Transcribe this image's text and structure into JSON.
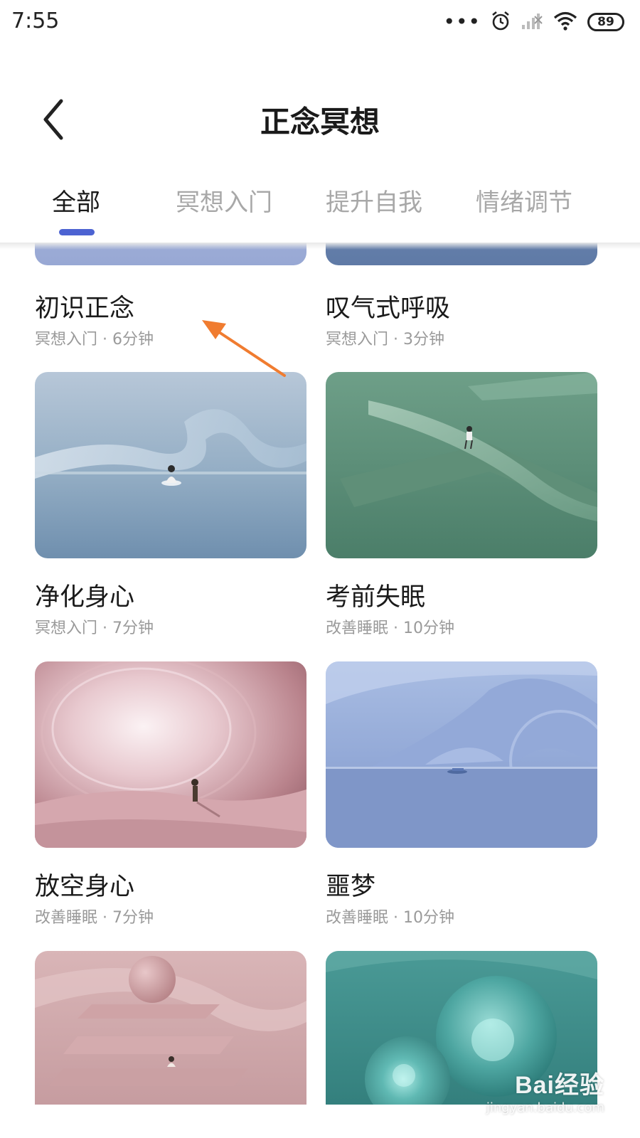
{
  "status_bar": {
    "time": "7:55",
    "dots": "•••",
    "battery": "89",
    "icons": [
      "alarm-icon",
      "signal-icon",
      "wifi-icon",
      "battery-icon"
    ]
  },
  "header": {
    "title": "正念冥想",
    "back_icon": "chevron-left-icon"
  },
  "tabs": [
    {
      "label": "全部",
      "active": true
    },
    {
      "label": "冥想入门",
      "active": false
    },
    {
      "label": "提升自我",
      "active": false
    },
    {
      "label": "情绪调节",
      "active": false
    }
  ],
  "colors": {
    "tab_indicator": "#4c63d2",
    "annotation_arrow": "#f07c30",
    "title_text": "#1a1a1a",
    "subtitle_text": "#9a9a9a"
  },
  "cards": [
    {
      "title": "初识正念",
      "subtitle": "冥想入门 · 6分钟",
      "theme": "periwinkle"
    },
    {
      "title": "叹气式呼吸",
      "subtitle": "冥想入门 · 3分钟",
      "theme": "steel-blue"
    },
    {
      "title": "净化身心",
      "subtitle": "冥想入门 · 7分钟",
      "theme": "misty-blue ribbon"
    },
    {
      "title": "考前失眠",
      "subtitle": "改善睡眠 · 10分钟",
      "theme": "sage-green"
    },
    {
      "title": "放空身心",
      "subtitle": "改善睡眠 · 7分钟",
      "theme": "dusty-pink glow"
    },
    {
      "title": "噩梦",
      "subtitle": "改善睡眠 · 10分钟",
      "theme": "lavender-blue cave"
    },
    {
      "title": "",
      "subtitle": "",
      "theme": "rose steps"
    },
    {
      "title": "",
      "subtitle": "",
      "theme": "teal spheres"
    }
  ],
  "watermark": {
    "logo": "Bai经验",
    "url": "jingyan.baidu.com"
  }
}
